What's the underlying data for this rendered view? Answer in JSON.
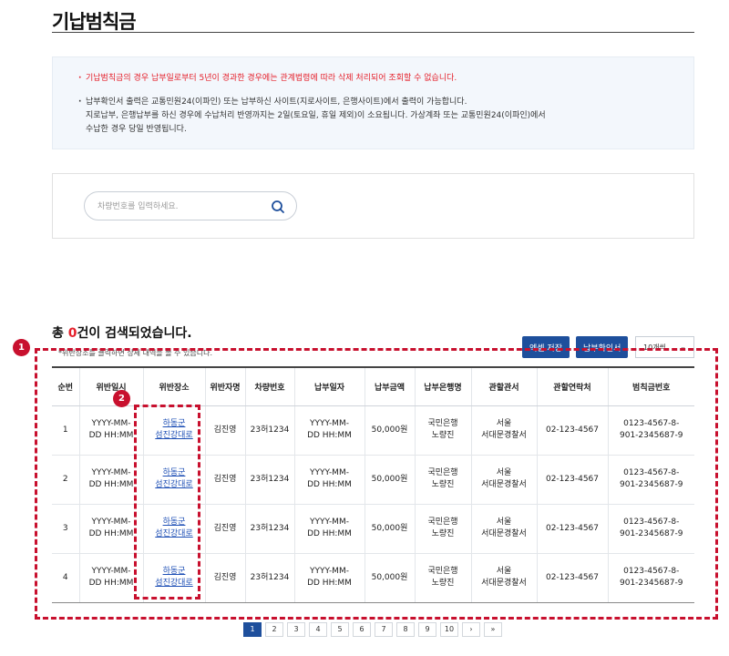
{
  "page": {
    "title": "기납범칙금"
  },
  "notice": {
    "warning": "기납범칙금의 경우 납부일로부터 5년이 경과한 경우에는 관계법령에 따라 삭제 처리되어 조회할 수 없습니다.",
    "info_line1": "납부확인서 출력은 교통민원24(이파인) 또는 납부하신 사이트(지로사이트, 은행사이트)에서 출력이 가능합니다.",
    "info_line2": "지로납부, 은행납부를 하신 경우에 수납처리 반영까지는 2일(토요일, 휴일 제외)이 소요됩니다. 가상계좌 또는 교통민원24(이파인)에서",
    "info_line3": "수납한 경우 당일 반영됩니다."
  },
  "search": {
    "placeholder": "차량번호를 입력하세요.",
    "value": "",
    "icon": "search-icon"
  },
  "results": {
    "prefix": "총 ",
    "count": "0",
    "suffix": "건이 검색되었습니다.",
    "hint": "*위반장소를 클릭하면 상세 내역을 볼 수 있습니다."
  },
  "toolbar": {
    "excel_label": "엑셀 저장",
    "receipt_label": "납부확인서",
    "rows_label": "10개씩",
    "rows_icon": "chevron-down-icon"
  },
  "table": {
    "headers": [
      "순번",
      "위반일시",
      "위반장소",
      "위반자명",
      "차량번호",
      "납부일자",
      "납부금액",
      "납부은행명",
      "관할관서",
      "관할연락처",
      "범칙금번호"
    ],
    "rows": [
      {
        "no": "1",
        "date_l1": "YYYY-MM-",
        "date_l2": "DD HH:MM",
        "loc_l1": "하동군",
        "loc_l2": "섬진강대로",
        "name": "김진영",
        "car": "23허1234",
        "paid_l1": "YYYY-MM-",
        "paid_l2": "DD HH:MM",
        "amount": "50,000원",
        "bank_l1": "국민은행",
        "bank_l2": "노량진",
        "office_l1": "서울",
        "office_l2": "서대문경찰서",
        "phone": "02-123-4567",
        "fine_l1": "0123-4567-8-",
        "fine_l2": "901-2345687-9"
      },
      {
        "no": "2",
        "date_l1": "YYYY-MM-",
        "date_l2": "DD HH:MM",
        "loc_l1": "하동군",
        "loc_l2": "섬진강대로",
        "name": "김진영",
        "car": "23허1234",
        "paid_l1": "YYYY-MM-",
        "paid_l2": "DD HH:MM",
        "amount": "50,000원",
        "bank_l1": "국민은행",
        "bank_l2": "노량진",
        "office_l1": "서울",
        "office_l2": "서대문경찰서",
        "phone": "02-123-4567",
        "fine_l1": "0123-4567-8-",
        "fine_l2": "901-2345687-9"
      },
      {
        "no": "3",
        "date_l1": "YYYY-MM-",
        "date_l2": "DD HH:MM",
        "loc_l1": "하동군",
        "loc_l2": "섬진강대로",
        "name": "김진영",
        "car": "23허1234",
        "paid_l1": "YYYY-MM-",
        "paid_l2": "DD HH:MM",
        "amount": "50,000원",
        "bank_l1": "국민은행",
        "bank_l2": "노량진",
        "office_l1": "서울",
        "office_l2": "서대문경찰서",
        "phone": "02-123-4567",
        "fine_l1": "0123-4567-8-",
        "fine_l2": "901-2345687-9"
      },
      {
        "no": "4",
        "date_l1": "YYYY-MM-",
        "date_l2": "DD HH:MM",
        "loc_l1": "하동군",
        "loc_l2": "섬진강대로",
        "name": "김진영",
        "car": "23허1234",
        "paid_l1": "YYYY-MM-",
        "paid_l2": "DD HH:MM",
        "amount": "50,000원",
        "bank_l1": "국민은행",
        "bank_l2": "노량진",
        "office_l1": "서울",
        "office_l2": "서대문경찰서",
        "phone": "02-123-4567",
        "fine_l1": "0123-4567-8-",
        "fine_l2": "901-2345687-9"
      }
    ]
  },
  "annotations": {
    "badge1": "1",
    "badge2": "2",
    "color": "#c8102e"
  },
  "pagination": {
    "pages": [
      "1",
      "2",
      "3",
      "4",
      "5",
      "6",
      "7",
      "8",
      "9",
      "10"
    ],
    "active": "1",
    "next": "›",
    "last": "»"
  },
  "colors": {
    "accent": "#1e4f9c",
    "warning": "#e5212c",
    "link": "#1e4fb5"
  }
}
